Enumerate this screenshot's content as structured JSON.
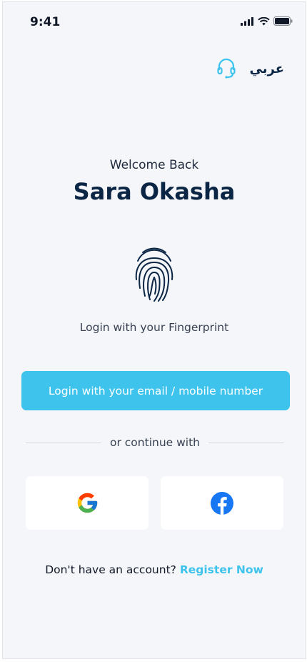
{
  "status_bar": {
    "time": "9:41",
    "icons": [
      "signal-icon",
      "wifi-icon",
      "battery-icon"
    ]
  },
  "top": {
    "support_icon": "headset-icon",
    "language_label": "عربي"
  },
  "welcome": {
    "greeting": "Welcome Back",
    "user_name": "Sara Okasha"
  },
  "fingerprint": {
    "icon": "fingerprint-icon",
    "label": "Login with your Fingerprint"
  },
  "login_button": {
    "label": "Login with your email / mobile number"
  },
  "divider": {
    "label": "or continue with"
  },
  "social": [
    {
      "name": "google",
      "icon": "google-icon"
    },
    {
      "name": "facebook",
      "icon": "facebook-icon"
    }
  ],
  "register": {
    "prompt": "Don't have an account?",
    "link": "Register Now"
  },
  "colors": {
    "accent": "#3ec3ec",
    "navy": "#0b2545",
    "background": "#f4f6f9"
  }
}
